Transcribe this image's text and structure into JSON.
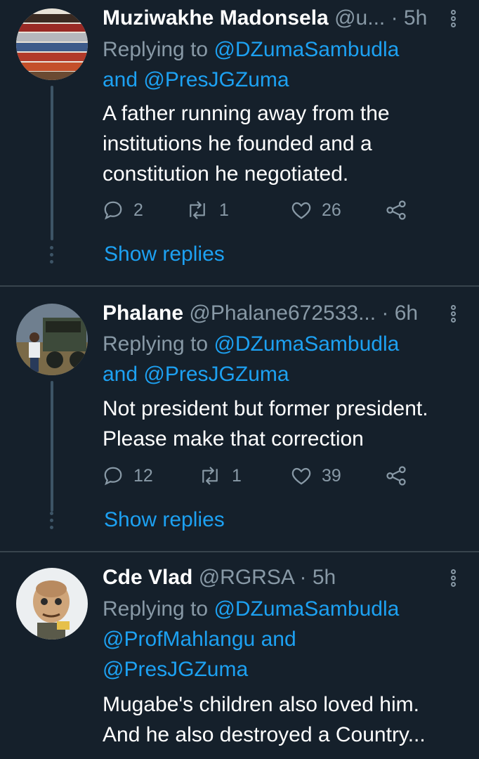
{
  "tweets": [
    {
      "name": "Muziwakhe Madonsela",
      "handle": "@u...",
      "time": "· 5h",
      "replying_prefix": "Replying to ",
      "mentions": [
        "@DZumaSambudla",
        "and",
        "@PresJGZuma"
      ],
      "body_lines": [
        "A father running away from the",
        "institutions he founded and a",
        "constitution he negotiated."
      ],
      "replies": "2",
      "retweets": "1",
      "likes": "26",
      "show_replies": "Show replies"
    },
    {
      "name": "Phalane",
      "handle": "@Phalane672533...",
      "time": "· 6h",
      "replying_prefix": "Replying to ",
      "mentions": [
        "@DZumaSambudla",
        "and",
        "@PresJGZuma"
      ],
      "body_lines": [
        "Not president but former president.",
        "Please make that correction"
      ],
      "replies": "12",
      "retweets": "1",
      "likes": "39",
      "show_replies": "Show replies"
    },
    {
      "name": "Cde Vlad",
      "handle": "@RGRSA",
      "time": "· 5h",
      "replying_prefix": "Replying to ",
      "mentions": [
        "@DZumaSambudla",
        "@ProfMahlangu",
        "and",
        "@PresJGZuma"
      ],
      "body_lines": [
        "Mugabe's children also loved him.",
        "And he also destroyed a Country..."
      ]
    }
  ],
  "colors": {
    "background": "#15202b",
    "accent": "#1da1f2",
    "muted": "#8899a6",
    "separator": "#38444d"
  },
  "icons": [
    "reply-icon",
    "retweet-icon",
    "like-icon",
    "share-icon",
    "more-icon"
  ]
}
